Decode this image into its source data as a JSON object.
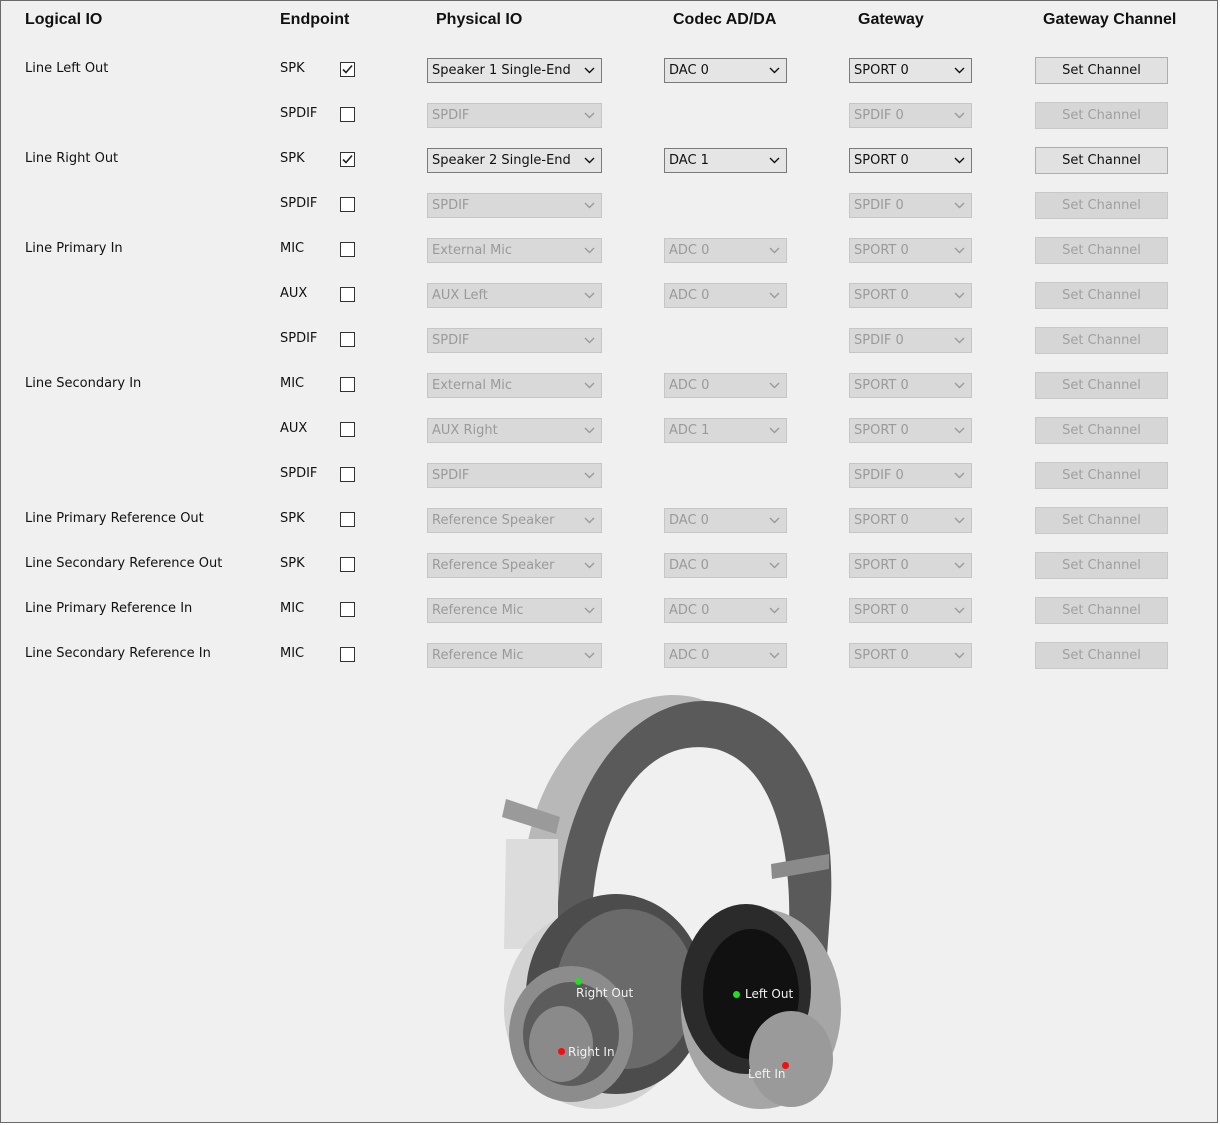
{
  "headers": {
    "logical": "Logical IO",
    "endpoint": "Endpoint",
    "physical": "Physical IO",
    "codec": "Codec AD/DA",
    "gateway": "Gateway",
    "channel": "Gateway Channel"
  },
  "rows": [
    {
      "logical": "Line Left Out",
      "endpoint": "SPK",
      "checked": true,
      "physical": "Speaker 1 Single-End",
      "codec": "DAC 0",
      "gateway": "SPORT 0",
      "button": "Set Channel",
      "enabled": true
    },
    {
      "logical": "",
      "endpoint": "SPDIF",
      "checked": false,
      "physical": "SPDIF",
      "codec": "",
      "gateway": "SPDIF 0",
      "button": "Set Channel",
      "enabled": false
    },
    {
      "logical": "Line Right Out",
      "endpoint": "SPK",
      "checked": true,
      "physical": "Speaker 2 Single-End",
      "codec": "DAC 1",
      "gateway": "SPORT 0",
      "button": "Set Channel",
      "enabled": true
    },
    {
      "logical": "",
      "endpoint": "SPDIF",
      "checked": false,
      "physical": "SPDIF",
      "codec": "",
      "gateway": "SPDIF 0",
      "button": "Set Channel",
      "enabled": false
    },
    {
      "logical": "Line Primary In",
      "endpoint": "MIC",
      "checked": false,
      "physical": "External Mic",
      "codec": "ADC 0",
      "gateway": "SPORT 0",
      "button": "Set Channel",
      "enabled": false
    },
    {
      "logical": "",
      "endpoint": "AUX",
      "checked": false,
      "physical": "AUX Left",
      "codec": "ADC 0",
      "gateway": "SPORT 0",
      "button": "Set Channel",
      "enabled": false
    },
    {
      "logical": "",
      "endpoint": "SPDIF",
      "checked": false,
      "physical": "SPDIF",
      "codec": "",
      "gateway": "SPDIF 0",
      "button": "Set Channel",
      "enabled": false
    },
    {
      "logical": "Line Secondary In",
      "endpoint": "MIC",
      "checked": false,
      "physical": "External Mic",
      "codec": "ADC 0",
      "gateway": "SPORT 0",
      "button": "Set Channel",
      "enabled": false
    },
    {
      "logical": "",
      "endpoint": "AUX",
      "checked": false,
      "physical": "AUX Right",
      "codec": "ADC 1",
      "gateway": "SPORT 0",
      "button": "Set Channel",
      "enabled": false
    },
    {
      "logical": "",
      "endpoint": "SPDIF",
      "checked": false,
      "physical": "SPDIF",
      "codec": "",
      "gateway": "SPDIF 0",
      "button": "Set Channel",
      "enabled": false
    },
    {
      "logical": "Line Primary Reference Out",
      "endpoint": "SPK",
      "checked": false,
      "physical": "Reference Speaker",
      "codec": "DAC 0",
      "gateway": "SPORT 0",
      "button": "Set Channel",
      "enabled": false
    },
    {
      "logical": "Line Secondary Reference Out",
      "endpoint": "SPK",
      "checked": false,
      "physical": "Reference Speaker",
      "codec": "DAC 0",
      "gateway": "SPORT 0",
      "button": "Set Channel",
      "enabled": false
    },
    {
      "logical": "Line Primary Reference In",
      "endpoint": "MIC",
      "checked": false,
      "physical": "Reference Mic",
      "codec": "ADC 0",
      "gateway": "SPORT 0",
      "button": "Set Channel",
      "enabled": false
    },
    {
      "logical": "Line Secondary Reference In",
      "endpoint": "MIC",
      "checked": false,
      "physical": "Reference Mic",
      "codec": "ADC 0",
      "gateway": "SPORT 0",
      "button": "Set Channel",
      "enabled": false
    }
  ],
  "headphones": {
    "right_out": "Right Out",
    "left_out": "Left Out",
    "right_in": "Right In",
    "left_in": "Left In",
    "out_color": "#22dd22",
    "in_color": "#ee1111"
  }
}
